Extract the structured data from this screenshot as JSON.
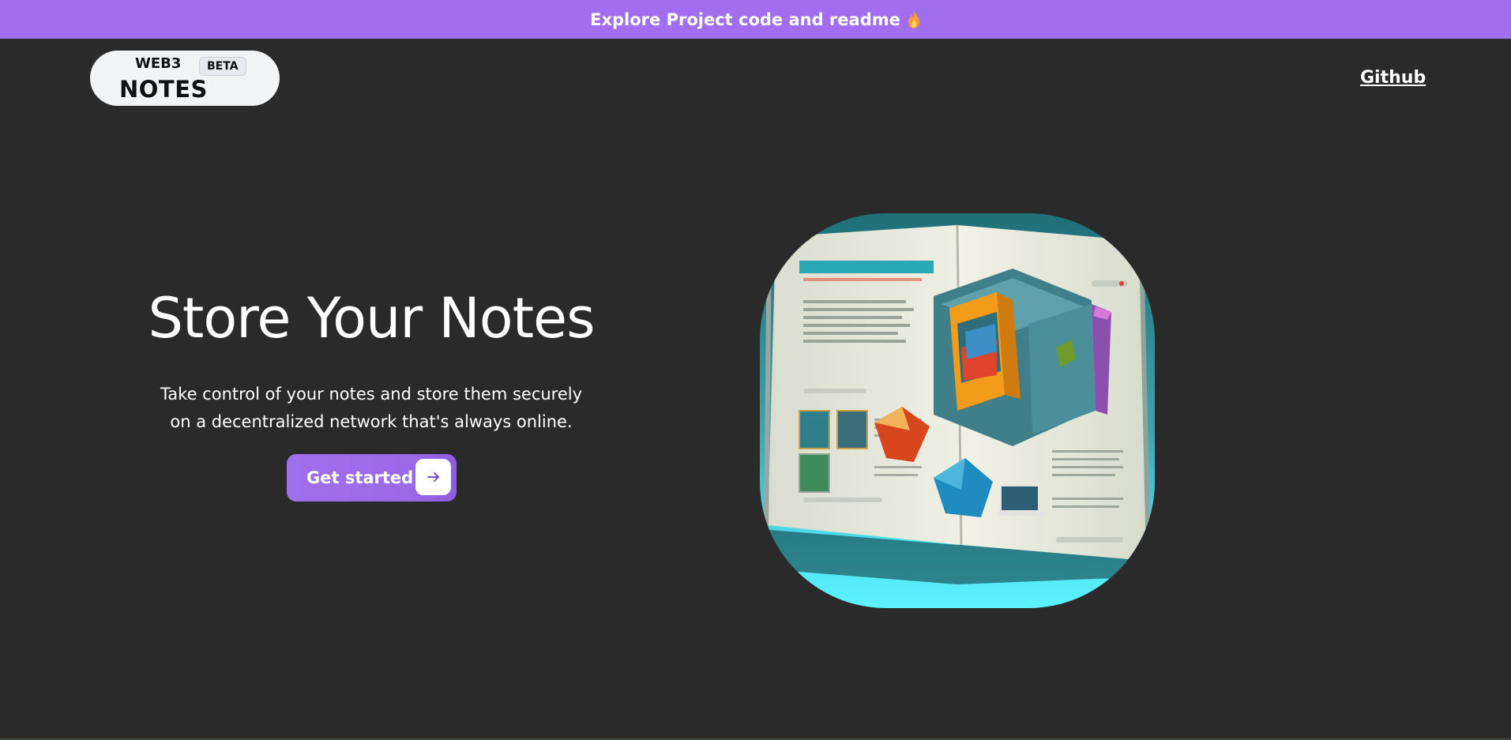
{
  "banner": {
    "text": "Explore Project code and readme",
    "icon": "flame-icon",
    "background": "#a16ef0"
  },
  "header": {
    "logo_top": "WEB3",
    "logo_badge": "BETA",
    "logo_main": "NOTES",
    "github_label": "Github"
  },
  "hero": {
    "title": "Store Your Notes",
    "subtitle_line1": "Take control of your notes and store them securely",
    "subtitle_line2": "on a decentralized network that's always online.",
    "cta_label": "Get started",
    "cta_icon": "arrow-right-icon",
    "image": "open-book-illustration"
  },
  "colors": {
    "background": "#2a2a2a",
    "accent": "#a06fee",
    "logo_bg": "#f2f3f5"
  }
}
